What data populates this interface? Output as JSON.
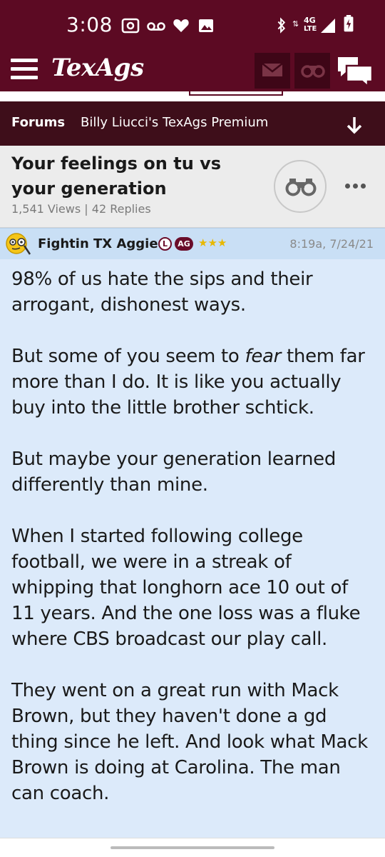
{
  "status_bar": {
    "time": "3:08",
    "network": "4G",
    "network_sub": "LTE"
  },
  "app": {
    "logo": "TexAgs"
  },
  "breadcrumb": {
    "forums": "Forums",
    "section": "Billy Liucci's TexAgs Premium"
  },
  "thread": {
    "title": "Your feelings on tu vs your generation",
    "meta": "1,541 Views | 42 Replies"
  },
  "post": {
    "author": "Fightin TX Aggie",
    "badge_l": "L",
    "badge_ag": "AG",
    "stars": "★★★",
    "time": "8:19a, 7/24/21",
    "p1": "98% of us hate the sips and their arrogant, dishonest ways.",
    "p2_before": "But some of you seem to ",
    "p2_em": "fear",
    "p2_after": " them far more than I do. It is like you actually buy into the little brother schtick.",
    "p3": "But maybe your generation learned differently than mine.",
    "p4": "When I started following college football, we were in a streak of whipping that longhorn ace 10 out of 11 years. And the one loss was a fluke where CBS broadcast our play call.",
    "p5": "They went on a great run with Mack Brown, but they haven't done a gd thing since he left. And look what Mack Brown is doing at Carolina. The man can coach."
  },
  "colors": {
    "maroon": "#5c0a23",
    "breadcrumb_bg": "#3e0e1a",
    "post_header_bg": "#c9dff5",
    "post_body_bg": "#dceafa"
  },
  "icons": {
    "status": [
      "radio-icon",
      "voicemail-icon",
      "heart-icon",
      "image-icon",
      "bluetooth-icon",
      "signal-icon",
      "battery-icon"
    ],
    "header": [
      "menu-icon",
      "mail-icon",
      "binoculars-icon",
      "chat-icon"
    ],
    "thread": [
      "download-arrow-icon",
      "binoculars-icon",
      "more-icon"
    ]
  }
}
